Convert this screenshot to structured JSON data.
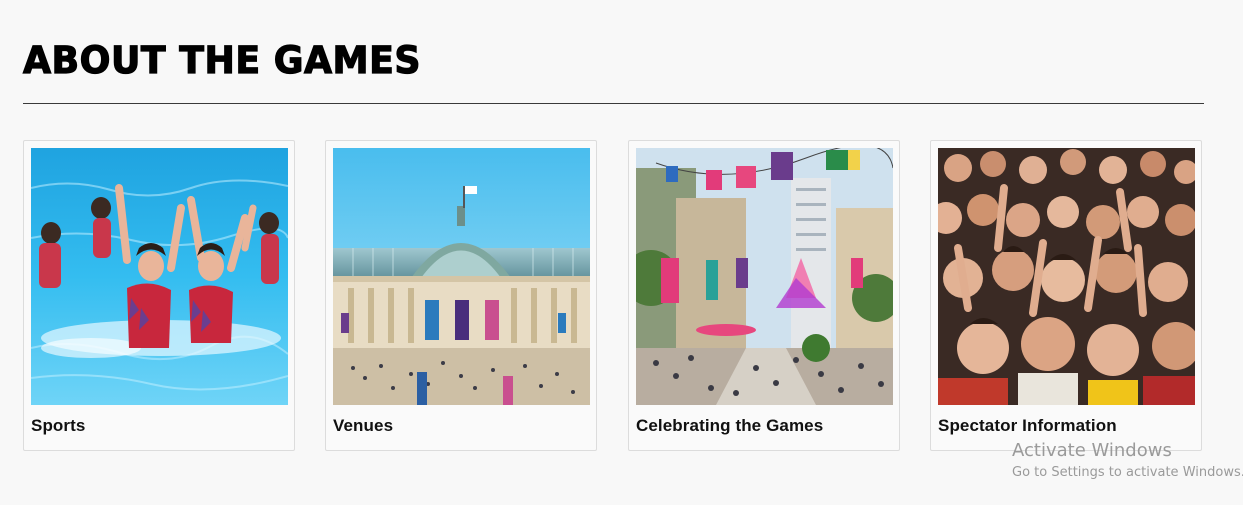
{
  "section": {
    "title": "ABOUT THE GAMES"
  },
  "cards": [
    {
      "label": "Sports",
      "image": "artistic-swimming-photo"
    },
    {
      "label": "Venues",
      "image": "grand-palais-photo"
    },
    {
      "label": "Celebrating the Games",
      "image": "city-celebration-photo"
    },
    {
      "label": "Spectator Information",
      "image": "crowd-photo"
    }
  ],
  "watermark": {
    "title": "Activate Windows",
    "subtitle": "Go to Settings to activate Windows."
  },
  "colors": {
    "background": "#f8f8f8",
    "card_border": "#dcdcdc",
    "divider": "#3a3a3a",
    "pool_blue": "#2fb4ea",
    "sky_blue": "#5ec8f0",
    "paris_purple": "#6a3c8c",
    "paris_pink": "#e23b7a",
    "crowd_red": "#c0392b"
  }
}
